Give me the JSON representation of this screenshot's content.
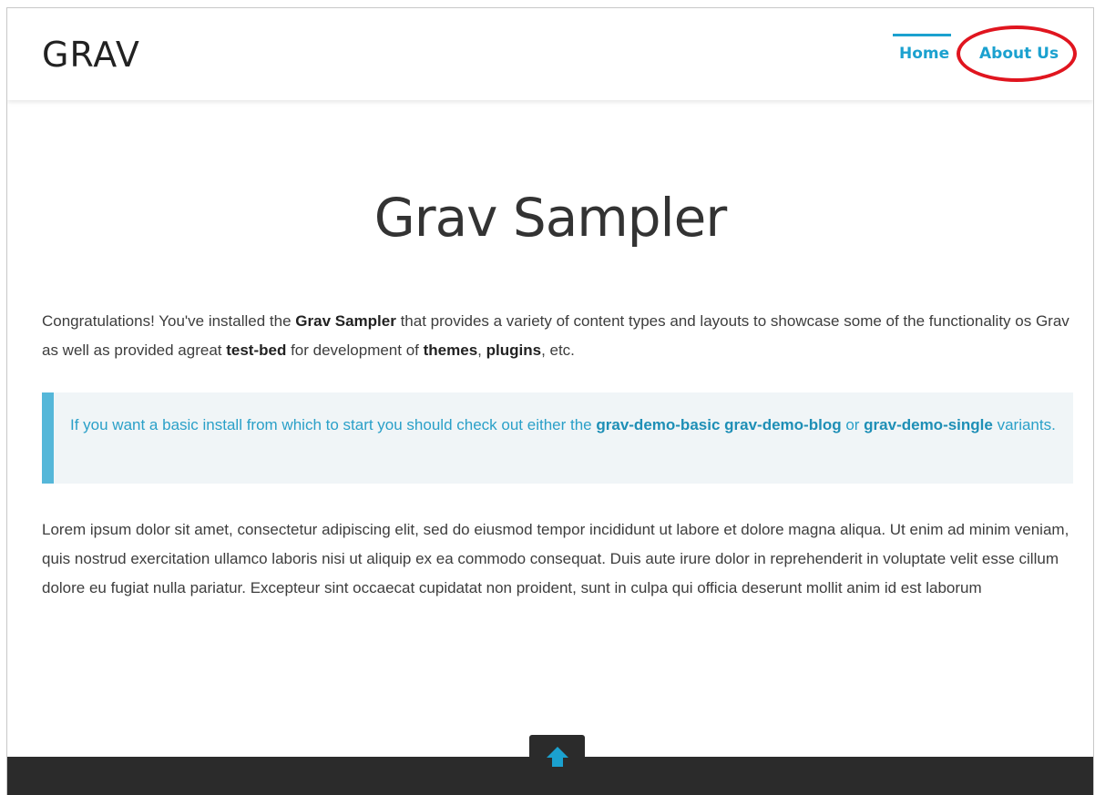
{
  "header": {
    "logo": "GRAV",
    "nav": [
      {
        "label": "Home",
        "active": true
      },
      {
        "label": "About Us",
        "active": false
      }
    ]
  },
  "main": {
    "title": "Grav Sampler",
    "intro": {
      "t1": "Congratulations! You've installed the ",
      "b1": "Grav Sampler",
      "t2": " that provides a variety of content types and layouts to showcase some of the functionality os Grav as well as provided agreat ",
      "b2": "test-bed",
      "t3": " for development of ",
      "b3": "themes",
      "t4": ", ",
      "b4": "plugins",
      "t5": ", etc."
    },
    "notice": {
      "t1": "If you want a basic install from which to start you should check out either the ",
      "link1": "grav-demo-basic",
      "t2": " ",
      "link2": "grav-demo-blog",
      "t3": " or ",
      "link3": "grav-demo-single",
      "t4": " variants."
    },
    "lorem": "Lorem ipsum dolor sit amet, consectetur adipiscing elit, sed do eiusmod tempor incididunt ut labore et dolore magna aliqua. Ut enim ad minim veniam, quis nostrud exercitation ullamco laboris nisi ut aliquip ex ea commodo consequat. Duis aute irure dolor in reprehenderit in voluptate velit esse cillum dolore eu fugiat nulla pariatur. Excepteur sint occaecat cupidatat non proident, sunt in culpa qui officia deserunt mollit anim id est laborum"
  },
  "footer": {
    "back_to_top_icon": "arrow-up-icon"
  },
  "colors": {
    "accent": "#1ba1cf",
    "highlight": "#e0151f",
    "footer": "#2b2b2b",
    "notice_bg": "#f0f5f7"
  }
}
